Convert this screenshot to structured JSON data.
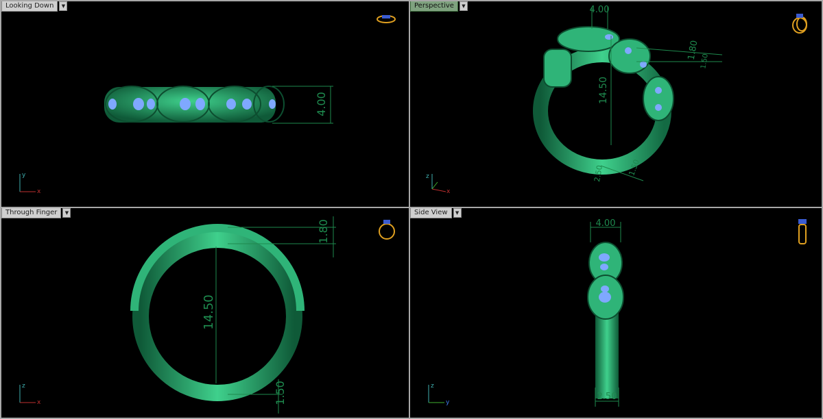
{
  "viewports": [
    {
      "label": "Looking Down",
      "active": false,
      "axis_x": "x",
      "axis_y": "y",
      "dims": [
        "4.00"
      ]
    },
    {
      "label": "Perspective",
      "active": true,
      "axis_x": "x",
      "axis_y": "z",
      "dims": [
        "4.00",
        "14.50",
        "1.80",
        "1.50",
        "2.50",
        "1.50"
      ]
    },
    {
      "label": "Through Finger",
      "active": false,
      "axis_x": "x",
      "axis_y": "z",
      "dims": [
        "1.80",
        "14.50",
        "1.50"
      ]
    },
    {
      "label": "Side View",
      "active": false,
      "axis_x": "y",
      "axis_y": "z",
      "dims": [
        "4.00",
        "2.50"
      ]
    }
  ],
  "colors": {
    "metal": "#2fb478",
    "metal_dark": "#136a43",
    "gem": "#7fa8ff",
    "dim_line": "#1e8a4e",
    "ring_icon": "#e0a020"
  }
}
